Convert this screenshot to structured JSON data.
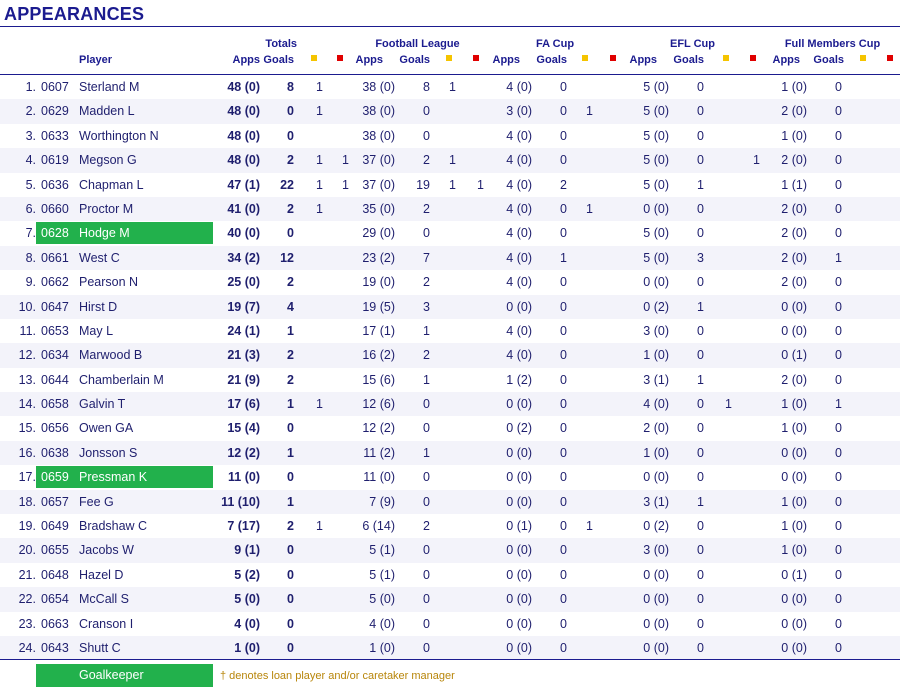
{
  "title": "APPEARANCES",
  "headers": {
    "player": "Player",
    "totals": "Totals",
    "football_league": "Football League",
    "fa_cup": "FA Cup",
    "efl_cup": "EFL Cup",
    "full_members_cup": "Full Members Cup",
    "apps": "Apps",
    "goals": "Goals"
  },
  "card_colors": {
    "yellow": "#f5c400",
    "red": "#e00000"
  },
  "highlight_color": "#22b14c",
  "legend": {
    "goalkeeper": "Goalkeeper",
    "note": "† denotes loan player and/or caretaker manager"
  },
  "rows": [
    {
      "no": "1.",
      "code": "0607",
      "name": "Sterland M",
      "gk": false,
      "tot_apps": "48 (0)",
      "tot_goals": "8",
      "tot_y": "1",
      "tot_r": "",
      "fl_apps": "38 (0)",
      "fl_goals": "8",
      "fl_y": "1",
      "fl_r": "",
      "fa_apps": "4 (0)",
      "fa_goals": "0",
      "fa_y": "",
      "fa_r": "",
      "efl_apps": "5 (0)",
      "efl_goals": "0",
      "efl_y": "",
      "efl_r": "",
      "fmc_apps": "1 (0)",
      "fmc_goals": "0",
      "fmc_y": "",
      "fmc_r": ""
    },
    {
      "no": "2.",
      "code": "0629",
      "name": "Madden L",
      "gk": false,
      "tot_apps": "48 (0)",
      "tot_goals": "0",
      "tot_y": "1",
      "tot_r": "",
      "fl_apps": "38 (0)",
      "fl_goals": "0",
      "fl_y": "",
      "fl_r": "",
      "fa_apps": "3 (0)",
      "fa_goals": "0",
      "fa_y": "1",
      "fa_r": "",
      "efl_apps": "5 (0)",
      "efl_goals": "0",
      "efl_y": "",
      "efl_r": "",
      "fmc_apps": "2 (0)",
      "fmc_goals": "0",
      "fmc_y": "",
      "fmc_r": ""
    },
    {
      "no": "3.",
      "code": "0633",
      "name": "Worthington N",
      "gk": false,
      "tot_apps": "48 (0)",
      "tot_goals": "0",
      "tot_y": "",
      "tot_r": "",
      "fl_apps": "38 (0)",
      "fl_goals": "0",
      "fl_y": "",
      "fl_r": "",
      "fa_apps": "4 (0)",
      "fa_goals": "0",
      "fa_y": "",
      "fa_r": "",
      "efl_apps": "5 (0)",
      "efl_goals": "0",
      "efl_y": "",
      "efl_r": "",
      "fmc_apps": "1 (0)",
      "fmc_goals": "0",
      "fmc_y": "",
      "fmc_r": ""
    },
    {
      "no": "4.",
      "code": "0619",
      "name": "Megson G",
      "gk": false,
      "tot_apps": "48 (0)",
      "tot_goals": "2",
      "tot_y": "1",
      "tot_r": "1",
      "fl_apps": "37 (0)",
      "fl_goals": "2",
      "fl_y": "1",
      "fl_r": "",
      "fa_apps": "4 (0)",
      "fa_goals": "0",
      "fa_y": "",
      "fa_r": "",
      "efl_apps": "5 (0)",
      "efl_goals": "0",
      "efl_y": "",
      "efl_r": "1",
      "fmc_apps": "2 (0)",
      "fmc_goals": "0",
      "fmc_y": "",
      "fmc_r": ""
    },
    {
      "no": "5.",
      "code": "0636",
      "name": "Chapman L",
      "gk": false,
      "tot_apps": "47 (1)",
      "tot_goals": "22",
      "tot_y": "1",
      "tot_r": "1",
      "fl_apps": "37 (0)",
      "fl_goals": "19",
      "fl_y": "1",
      "fl_r": "1",
      "fa_apps": "4 (0)",
      "fa_goals": "2",
      "fa_y": "",
      "fa_r": "",
      "efl_apps": "5 (0)",
      "efl_goals": "1",
      "efl_y": "",
      "efl_r": "",
      "fmc_apps": "1 (1)",
      "fmc_goals": "0",
      "fmc_y": "",
      "fmc_r": ""
    },
    {
      "no": "6.",
      "code": "0660",
      "name": "Proctor M",
      "gk": false,
      "tot_apps": "41 (0)",
      "tot_goals": "2",
      "tot_y": "1",
      "tot_r": "",
      "fl_apps": "35 (0)",
      "fl_goals": "2",
      "fl_y": "",
      "fl_r": "",
      "fa_apps": "4 (0)",
      "fa_goals": "0",
      "fa_y": "1",
      "fa_r": "",
      "efl_apps": "0 (0)",
      "efl_goals": "0",
      "efl_y": "",
      "efl_r": "",
      "fmc_apps": "2 (0)",
      "fmc_goals": "0",
      "fmc_y": "",
      "fmc_r": ""
    },
    {
      "no": "7.",
      "code": "0628",
      "name": "Hodge M",
      "gk": true,
      "tot_apps": "40 (0)",
      "tot_goals": "0",
      "tot_y": "",
      "tot_r": "",
      "fl_apps": "29 (0)",
      "fl_goals": "0",
      "fl_y": "",
      "fl_r": "",
      "fa_apps": "4 (0)",
      "fa_goals": "0",
      "fa_y": "",
      "fa_r": "",
      "efl_apps": "5 (0)",
      "efl_goals": "0",
      "efl_y": "",
      "efl_r": "",
      "fmc_apps": "2 (0)",
      "fmc_goals": "0",
      "fmc_y": "",
      "fmc_r": ""
    },
    {
      "no": "8.",
      "code": "0661",
      "name": "West C",
      "gk": false,
      "tot_apps": "34 (2)",
      "tot_goals": "12",
      "tot_y": "",
      "tot_r": "",
      "fl_apps": "23 (2)",
      "fl_goals": "7",
      "fl_y": "",
      "fl_r": "",
      "fa_apps": "4 (0)",
      "fa_goals": "1",
      "fa_y": "",
      "fa_r": "",
      "efl_apps": "5 (0)",
      "efl_goals": "3",
      "efl_y": "",
      "efl_r": "",
      "fmc_apps": "2 (0)",
      "fmc_goals": "1",
      "fmc_y": "",
      "fmc_r": ""
    },
    {
      "no": "9.",
      "code": "0662",
      "name": "Pearson N",
      "gk": false,
      "tot_apps": "25 (0)",
      "tot_goals": "2",
      "tot_y": "",
      "tot_r": "",
      "fl_apps": "19 (0)",
      "fl_goals": "2",
      "fl_y": "",
      "fl_r": "",
      "fa_apps": "4 (0)",
      "fa_goals": "0",
      "fa_y": "",
      "fa_r": "",
      "efl_apps": "0 (0)",
      "efl_goals": "0",
      "efl_y": "",
      "efl_r": "",
      "fmc_apps": "2 (0)",
      "fmc_goals": "0",
      "fmc_y": "",
      "fmc_r": ""
    },
    {
      "no": "10.",
      "code": "0647",
      "name": "Hirst D",
      "gk": false,
      "tot_apps": "19 (7)",
      "tot_goals": "4",
      "tot_y": "",
      "tot_r": "",
      "fl_apps": "19 (5)",
      "fl_goals": "3",
      "fl_y": "",
      "fl_r": "",
      "fa_apps": "0 (0)",
      "fa_goals": "0",
      "fa_y": "",
      "fa_r": "",
      "efl_apps": "0 (2)",
      "efl_goals": "1",
      "efl_y": "",
      "efl_r": "",
      "fmc_apps": "0 (0)",
      "fmc_goals": "0",
      "fmc_y": "",
      "fmc_r": ""
    },
    {
      "no": "11.",
      "code": "0653",
      "name": "May L",
      "gk": false,
      "tot_apps": "24 (1)",
      "tot_goals": "1",
      "tot_y": "",
      "tot_r": "",
      "fl_apps": "17 (1)",
      "fl_goals": "1",
      "fl_y": "",
      "fl_r": "",
      "fa_apps": "4 (0)",
      "fa_goals": "0",
      "fa_y": "",
      "fa_r": "",
      "efl_apps": "3 (0)",
      "efl_goals": "0",
      "efl_y": "",
      "efl_r": "",
      "fmc_apps": "0 (0)",
      "fmc_goals": "0",
      "fmc_y": "",
      "fmc_r": ""
    },
    {
      "no": "12.",
      "code": "0634",
      "name": "Marwood B",
      "gk": false,
      "tot_apps": "21 (3)",
      "tot_goals": "2",
      "tot_y": "",
      "tot_r": "",
      "fl_apps": "16 (2)",
      "fl_goals": "2",
      "fl_y": "",
      "fl_r": "",
      "fa_apps": "4 (0)",
      "fa_goals": "0",
      "fa_y": "",
      "fa_r": "",
      "efl_apps": "1 (0)",
      "efl_goals": "0",
      "efl_y": "",
      "efl_r": "",
      "fmc_apps": "0 (1)",
      "fmc_goals": "0",
      "fmc_y": "",
      "fmc_r": ""
    },
    {
      "no": "13.",
      "code": "0644",
      "name": "Chamberlain M",
      "gk": false,
      "tot_apps": "21 (9)",
      "tot_goals": "2",
      "tot_y": "",
      "tot_r": "",
      "fl_apps": "15 (6)",
      "fl_goals": "1",
      "fl_y": "",
      "fl_r": "",
      "fa_apps": "1 (2)",
      "fa_goals": "0",
      "fa_y": "",
      "fa_r": "",
      "efl_apps": "3 (1)",
      "efl_goals": "1",
      "efl_y": "",
      "efl_r": "",
      "fmc_apps": "2 (0)",
      "fmc_goals": "0",
      "fmc_y": "",
      "fmc_r": ""
    },
    {
      "no": "14.",
      "code": "0658",
      "name": "Galvin T",
      "gk": false,
      "tot_apps": "17 (6)",
      "tot_goals": "1",
      "tot_y": "1",
      "tot_r": "",
      "fl_apps": "12 (6)",
      "fl_goals": "0",
      "fl_y": "",
      "fl_r": "",
      "fa_apps": "0 (0)",
      "fa_goals": "0",
      "fa_y": "",
      "fa_r": "",
      "efl_apps": "4 (0)",
      "efl_goals": "0",
      "efl_y": "1",
      "efl_r": "",
      "fmc_apps": "1 (0)",
      "fmc_goals": "1",
      "fmc_y": "",
      "fmc_r": ""
    },
    {
      "no": "15.",
      "code": "0656",
      "name": "Owen GA",
      "gk": false,
      "tot_apps": "15 (4)",
      "tot_goals": "0",
      "tot_y": "",
      "tot_r": "",
      "fl_apps": "12 (2)",
      "fl_goals": "0",
      "fl_y": "",
      "fl_r": "",
      "fa_apps": "0 (2)",
      "fa_goals": "0",
      "fa_y": "",
      "fa_r": "",
      "efl_apps": "2 (0)",
      "efl_goals": "0",
      "efl_y": "",
      "efl_r": "",
      "fmc_apps": "1 (0)",
      "fmc_goals": "0",
      "fmc_y": "",
      "fmc_r": ""
    },
    {
      "no": "16.",
      "code": "0638",
      "name": "Jonsson S",
      "gk": false,
      "tot_apps": "12 (2)",
      "tot_goals": "1",
      "tot_y": "",
      "tot_r": "",
      "fl_apps": "11 (2)",
      "fl_goals": "1",
      "fl_y": "",
      "fl_r": "",
      "fa_apps": "0 (0)",
      "fa_goals": "0",
      "fa_y": "",
      "fa_r": "",
      "efl_apps": "1 (0)",
      "efl_goals": "0",
      "efl_y": "",
      "efl_r": "",
      "fmc_apps": "0 (0)",
      "fmc_goals": "0",
      "fmc_y": "",
      "fmc_r": ""
    },
    {
      "no": "17.",
      "code": "0659",
      "name": "Pressman K",
      "gk": true,
      "tot_apps": "11 (0)",
      "tot_goals": "0",
      "tot_y": "",
      "tot_r": "",
      "fl_apps": "11 (0)",
      "fl_goals": "0",
      "fl_y": "",
      "fl_r": "",
      "fa_apps": "0 (0)",
      "fa_goals": "0",
      "fa_y": "",
      "fa_r": "",
      "efl_apps": "0 (0)",
      "efl_goals": "0",
      "efl_y": "",
      "efl_r": "",
      "fmc_apps": "0 (0)",
      "fmc_goals": "0",
      "fmc_y": "",
      "fmc_r": ""
    },
    {
      "no": "18.",
      "code": "0657",
      "name": "Fee G",
      "gk": false,
      "tot_apps": "11 (10)",
      "tot_goals": "1",
      "tot_y": "",
      "tot_r": "",
      "fl_apps": "7 (9)",
      "fl_goals": "0",
      "fl_y": "",
      "fl_r": "",
      "fa_apps": "0 (0)",
      "fa_goals": "0",
      "fa_y": "",
      "fa_r": "",
      "efl_apps": "3 (1)",
      "efl_goals": "1",
      "efl_y": "",
      "efl_r": "",
      "fmc_apps": "1 (0)",
      "fmc_goals": "0",
      "fmc_y": "",
      "fmc_r": ""
    },
    {
      "no": "19.",
      "code": "0649",
      "name": "Bradshaw C",
      "gk": false,
      "tot_apps": "7 (17)",
      "tot_goals": "2",
      "tot_y": "1",
      "tot_r": "",
      "fl_apps": "6 (14)",
      "fl_goals": "2",
      "fl_y": "",
      "fl_r": "",
      "fa_apps": "0 (1)",
      "fa_goals": "0",
      "fa_y": "1",
      "fa_r": "",
      "efl_apps": "0 (2)",
      "efl_goals": "0",
      "efl_y": "",
      "efl_r": "",
      "fmc_apps": "1 (0)",
      "fmc_goals": "0",
      "fmc_y": "",
      "fmc_r": ""
    },
    {
      "no": "20.",
      "code": "0655",
      "name": "Jacobs W",
      "gk": false,
      "tot_apps": "9 (1)",
      "tot_goals": "0",
      "tot_y": "",
      "tot_r": "",
      "fl_apps": "5 (1)",
      "fl_goals": "0",
      "fl_y": "",
      "fl_r": "",
      "fa_apps": "0 (0)",
      "fa_goals": "0",
      "fa_y": "",
      "fa_r": "",
      "efl_apps": "3 (0)",
      "efl_goals": "0",
      "efl_y": "",
      "efl_r": "",
      "fmc_apps": "1 (0)",
      "fmc_goals": "0",
      "fmc_y": "",
      "fmc_r": ""
    },
    {
      "no": "21.",
      "code": "0648",
      "name": "Hazel D",
      "gk": false,
      "tot_apps": "5 (2)",
      "tot_goals": "0",
      "tot_y": "",
      "tot_r": "",
      "fl_apps": "5 (1)",
      "fl_goals": "0",
      "fl_y": "",
      "fl_r": "",
      "fa_apps": "0 (0)",
      "fa_goals": "0",
      "fa_y": "",
      "fa_r": "",
      "efl_apps": "0 (0)",
      "efl_goals": "0",
      "efl_y": "",
      "efl_r": "",
      "fmc_apps": "0 (1)",
      "fmc_goals": "0",
      "fmc_y": "",
      "fmc_r": ""
    },
    {
      "no": "22.",
      "code": "0654",
      "name": "McCall S",
      "gk": false,
      "tot_apps": "5 (0)",
      "tot_goals": "0",
      "tot_y": "",
      "tot_r": "",
      "fl_apps": "5 (0)",
      "fl_goals": "0",
      "fl_y": "",
      "fl_r": "",
      "fa_apps": "0 (0)",
      "fa_goals": "0",
      "fa_y": "",
      "fa_r": "",
      "efl_apps": "0 (0)",
      "efl_goals": "0",
      "efl_y": "",
      "efl_r": "",
      "fmc_apps": "0 (0)",
      "fmc_goals": "0",
      "fmc_y": "",
      "fmc_r": ""
    },
    {
      "no": "23.",
      "code": "0663",
      "name": "Cranson I",
      "gk": false,
      "tot_apps": "4 (0)",
      "tot_goals": "0",
      "tot_y": "",
      "tot_r": "",
      "fl_apps": "4 (0)",
      "fl_goals": "0",
      "fl_y": "",
      "fl_r": "",
      "fa_apps": "0 (0)",
      "fa_goals": "0",
      "fa_y": "",
      "fa_r": "",
      "efl_apps": "0 (0)",
      "efl_goals": "0",
      "efl_y": "",
      "efl_r": "",
      "fmc_apps": "0 (0)",
      "fmc_goals": "0",
      "fmc_y": "",
      "fmc_r": ""
    },
    {
      "no": "24.",
      "code": "0643",
      "name": "Shutt C",
      "gk": false,
      "tot_apps": "1 (0)",
      "tot_goals": "0",
      "tot_y": "",
      "tot_r": "",
      "fl_apps": "1 (0)",
      "fl_goals": "0",
      "fl_y": "",
      "fl_r": "",
      "fa_apps": "0 (0)",
      "fa_goals": "0",
      "fa_y": "",
      "fa_r": "",
      "efl_apps": "0 (0)",
      "efl_goals": "0",
      "efl_y": "",
      "efl_r": "",
      "fmc_apps": "0 (0)",
      "fmc_goals": "0",
      "fmc_y": "",
      "fmc_r": ""
    }
  ]
}
